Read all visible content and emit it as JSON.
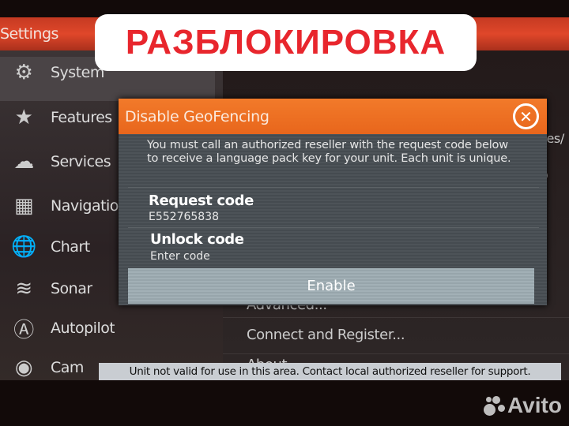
{
  "header": {
    "title": "Settings"
  },
  "overlay_banner": "РАЗБЛОКИРОВКА",
  "sidebar": {
    "items": [
      {
        "label": "System",
        "icon": "gear-icon",
        "glyph": "⚙",
        "selected": true
      },
      {
        "label": "Features",
        "icon": "star-icon",
        "glyph": "★"
      },
      {
        "label": "Services",
        "icon": "cloud-icon",
        "glyph": "☁"
      },
      {
        "label": "Navigation",
        "icon": "navigation-calculator-icon",
        "glyph": "▦"
      },
      {
        "label": "Chart",
        "icon": "globe-icon",
        "glyph": "🌐"
      },
      {
        "label": "Sonar",
        "icon": "sonar-icon",
        "glyph": "≋"
      },
      {
        "label": "Autopilot",
        "icon": "autopilot-icon",
        "glyph": "Ⓐ"
      },
      {
        "label": "Cam",
        "icon": "camera-icon",
        "glyph": "◉"
      }
    ]
  },
  "right_pane": {
    "fragments": [
      "ees/",
      "o"
    ],
    "items": [
      "Advanced...",
      "Connect and Register...",
      "About"
    ]
  },
  "dialog": {
    "title": "Disable GeoFencing",
    "message": "You must call an authorized reseller with the request code below to receive a language pack key for your unit.  Each unit is unique.",
    "request_label": "Request code",
    "request_value": "E552765838",
    "unlock_label": "Unlock code",
    "unlock_placeholder": "Enter code",
    "enable_label": "Enable"
  },
  "status_bar": "Unit not valid for use in this area.  Contact local authorized reseller for support.",
  "watermark": "Avito",
  "colors": {
    "accent": "#e8661c",
    "header": "#e0472a",
    "banner_text": "#e8262d"
  }
}
